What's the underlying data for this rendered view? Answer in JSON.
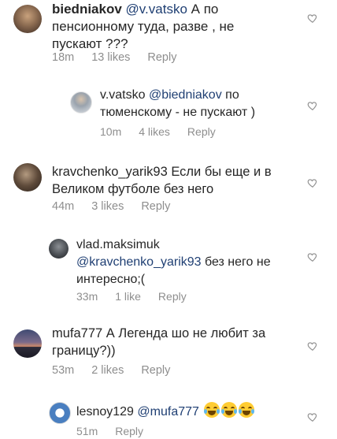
{
  "comments": [
    {
      "user": "biedniakov",
      "mention": "@v.vatsko",
      "text_line1": " А по",
      "text_line2": "пенсионному туда, разве , не",
      "text_line3": "пускают ???",
      "time": "18m",
      "likes": "13 likes",
      "reply": "Reply"
    },
    {
      "user": "v.vatsko",
      "mention": "@biedniakov",
      "text_line1": " по",
      "text_line2": "тюменскому - не пускают )",
      "time": "10m",
      "likes": "4 likes",
      "reply": "Reply"
    },
    {
      "user": "kravchenko_yarik93",
      "text_line1": " Если бы еще и в",
      "text_line2": "Великом футболе без него",
      "time": "44m",
      "likes": "3 likes",
      "reply": "Reply"
    },
    {
      "user": "vlad.maksimuk",
      "mention": "@kravchenko_yarik93",
      "text_line1": " без него не",
      "text_line2": "интересно;(",
      "time": "33m",
      "likes": "1 like",
      "reply": "Reply"
    },
    {
      "user": "mufa777",
      "text_line1": " А Легенда шо не любит за",
      "text_line2": "границу?))",
      "time": "53m",
      "likes": "2 likes",
      "reply": "Reply"
    },
    {
      "user": "lesnoy129",
      "mention": "@mufa777",
      "emoji": "😂😂😂",
      "time": "51m",
      "reply": "Reply"
    }
  ],
  "icons": {
    "like": "heart-outline-icon",
    "emoji": "tears-of-joy-emoji"
  },
  "colors": {
    "text": "#262626",
    "meta": "#8e8e8e",
    "mention": "#1f3f73",
    "heart": "#8e8e8e"
  }
}
